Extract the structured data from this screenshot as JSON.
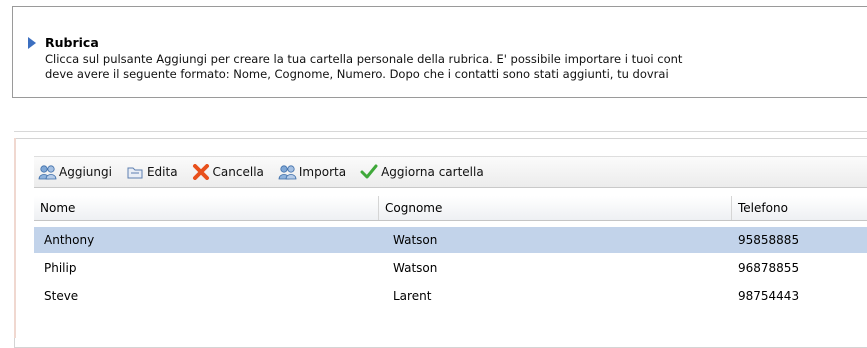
{
  "info": {
    "title": "Rubrica",
    "line1": "Clicca sul pulsante Aggiungi per creare la tua cartella personale della rubrica. E' possibile importare i tuoi cont",
    "line2": "deve avere il seguente formato: Nome, Cognome, Numero. Dopo che i contatti sono stati aggiunti, tu dovrai"
  },
  "toolbar": {
    "add_label": "Aggiungi",
    "edit_label": "Edita",
    "delete_label": "Cancella",
    "import_label": "Importa",
    "refresh_label": "Aggiorna cartella"
  },
  "table": {
    "columns": [
      "Nome",
      "Cognome",
      "Telefono"
    ],
    "rows": [
      {
        "nome": "Anthony",
        "cognome": "Watson",
        "telefono": "95858885",
        "selected": true
      },
      {
        "nome": "Philip",
        "cognome": "Watson",
        "telefono": "96878855",
        "selected": false
      },
      {
        "nome": "Steve",
        "cognome": "Larent",
        "telefono": "98754443",
        "selected": false
      }
    ]
  },
  "colors": {
    "selection": "#c2d3ea",
    "arrow": "#3c6fc0",
    "delete_icon": "#e8501c",
    "check_icon": "#3fa83a"
  }
}
